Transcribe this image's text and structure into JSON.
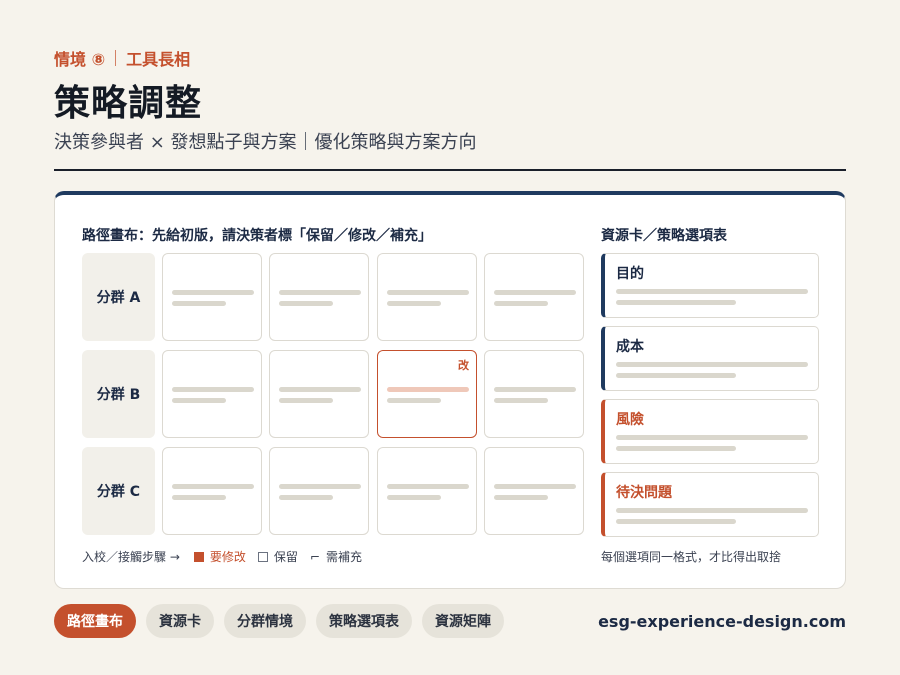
{
  "header": {
    "scenario": "情境 ⑧",
    "category": "工具長相",
    "title": "策略調整",
    "subtitle": "決策參與者 × 發想點子與方案｜優化策略與方案方向"
  },
  "main": {
    "heading": "路徑畫布：先給初版，請決策者標「保留／修改／補充」",
    "groups": [
      "分群 A",
      "分群 B",
      "分群 C"
    ],
    "edit_tag": "改",
    "legend": {
      "prefix": "入校／接觸步驟 →",
      "edit": "要修改",
      "keep": "保留",
      "supplement_mark": "⌐",
      "supplement": "需補充"
    }
  },
  "sidebar": {
    "heading": "資源卡／策略選項表",
    "cards": [
      {
        "title": "目的",
        "kind": "normal"
      },
      {
        "title": "成本",
        "kind": "normal"
      },
      {
        "title": "風險",
        "kind": "warn"
      },
      {
        "title": "待決問題",
        "kind": "warn"
      }
    ],
    "note": "每個選項同一格式，才比得出取捨"
  },
  "footer": {
    "tabs": [
      "路徑畫布",
      "資源卡",
      "分群情境",
      "策略選項表",
      "資源矩陣"
    ],
    "active_tab": 0,
    "site": "esg-experience-design.com"
  },
  "colors": {
    "accent": "#c4502d",
    "navy": "#1f3a5f",
    "background": "#f6f3ec"
  }
}
